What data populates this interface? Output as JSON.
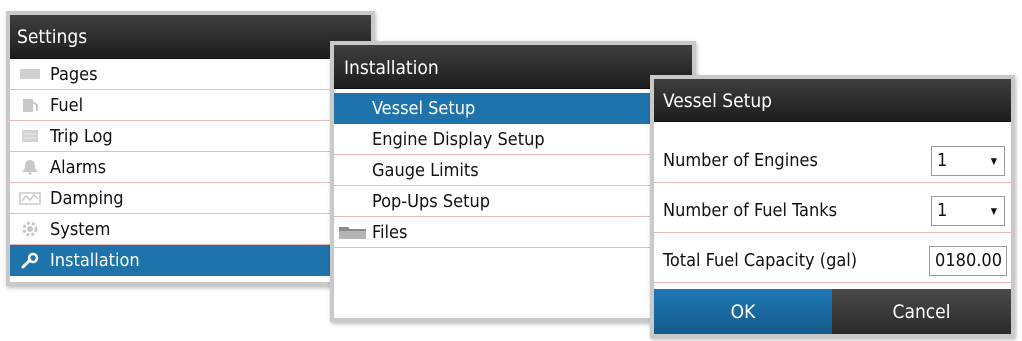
{
  "settings": {
    "title": "Settings",
    "items": [
      {
        "label": "Pages",
        "icon": "pages-icon"
      },
      {
        "label": "Fuel",
        "icon": "fuel-pump-icon"
      },
      {
        "label": "Trip Log",
        "icon": "trip-log-icon"
      },
      {
        "label": "Alarms",
        "icon": "bell-icon"
      },
      {
        "label": "Damping",
        "icon": "damping-icon"
      },
      {
        "label": "System",
        "icon": "gear-icon"
      },
      {
        "label": "Installation",
        "icon": "wrench-icon",
        "selected": true
      }
    ]
  },
  "installation": {
    "title": "Installation",
    "items": [
      {
        "label": "Vessel Setup",
        "selected": true
      },
      {
        "label": "Engine Display Setup"
      },
      {
        "label": "Gauge Limits"
      },
      {
        "label": "Pop-Ups Setup"
      },
      {
        "label": "Files",
        "icon": "folder-icon"
      }
    ]
  },
  "vessel_setup": {
    "title": "Vessel Setup",
    "fields": [
      {
        "label": "Number of Engines",
        "value": "1",
        "type": "select"
      },
      {
        "label": "Number of Fuel Tanks",
        "value": "1",
        "type": "select"
      },
      {
        "label": "Total Fuel Capacity (gal)",
        "value": "0180.00",
        "type": "number"
      }
    ],
    "ok_label": "OK",
    "cancel_label": "Cancel"
  },
  "colors": {
    "accent": "#1f73ad",
    "header": "#2b2b2b",
    "divider": "#e8b7b7"
  }
}
